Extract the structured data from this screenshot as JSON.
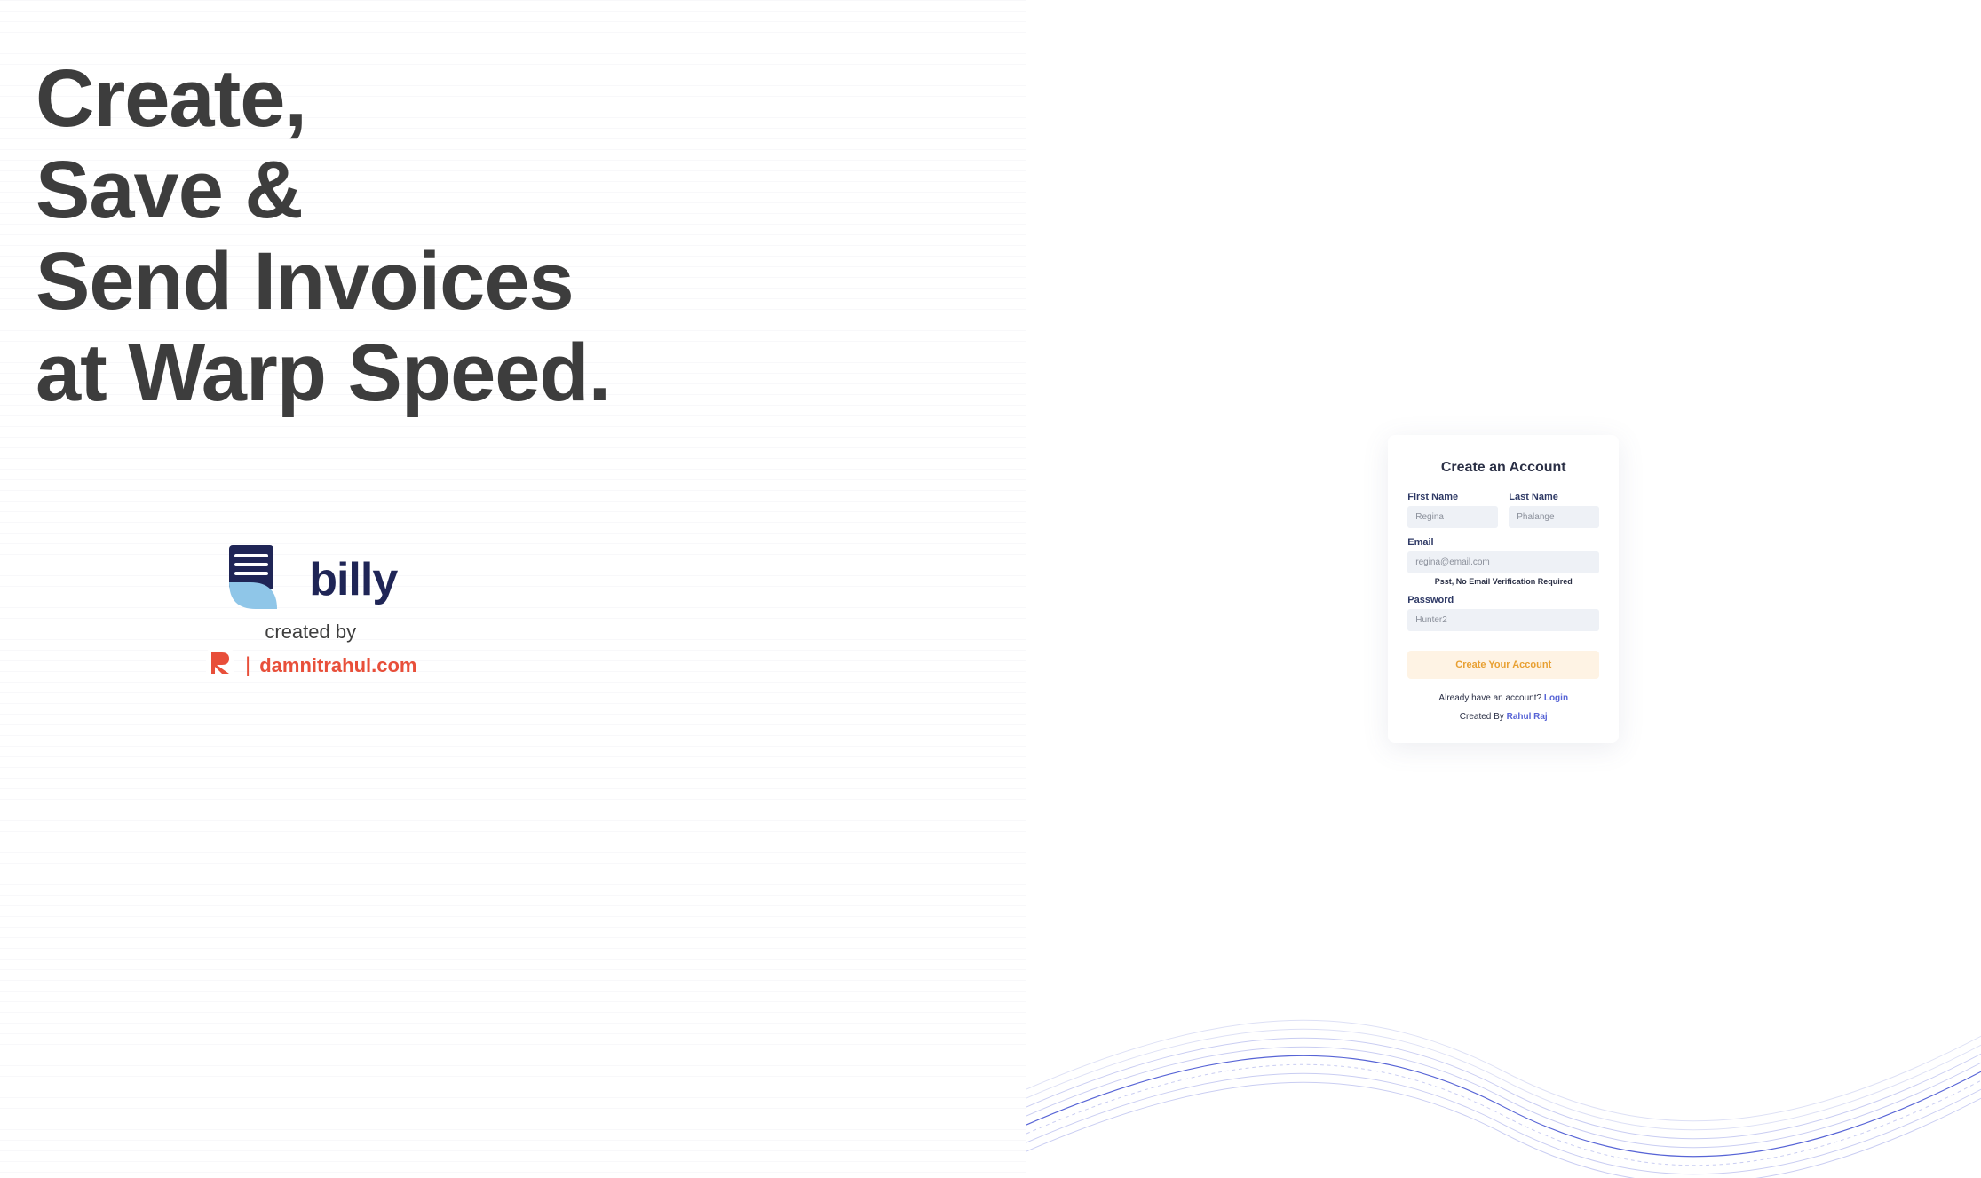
{
  "hero": {
    "line1": "Create,",
    "line2": "Save &",
    "line3": "Send Invoices",
    "line4": "at Warp Speed."
  },
  "brand": {
    "app_name": "billy",
    "created_by_label": "created by",
    "creator_site": "damnitrahul.com"
  },
  "form": {
    "title": "Create an Account",
    "first_name_label": "First Name",
    "first_name_placeholder": "Regina",
    "last_name_label": "Last Name",
    "last_name_placeholder": "Phalange",
    "email_label": "Email",
    "email_placeholder": "regina@email.com",
    "email_helper": "Psst, No Email Verification Required",
    "password_label": "Password",
    "password_placeholder": "Hunter2",
    "submit_label": "Create Your Account",
    "login_prompt": "Already have an account? ",
    "login_link": "Login",
    "credit_prefix": "Created By ",
    "credit_name": "Rahul Raj"
  }
}
